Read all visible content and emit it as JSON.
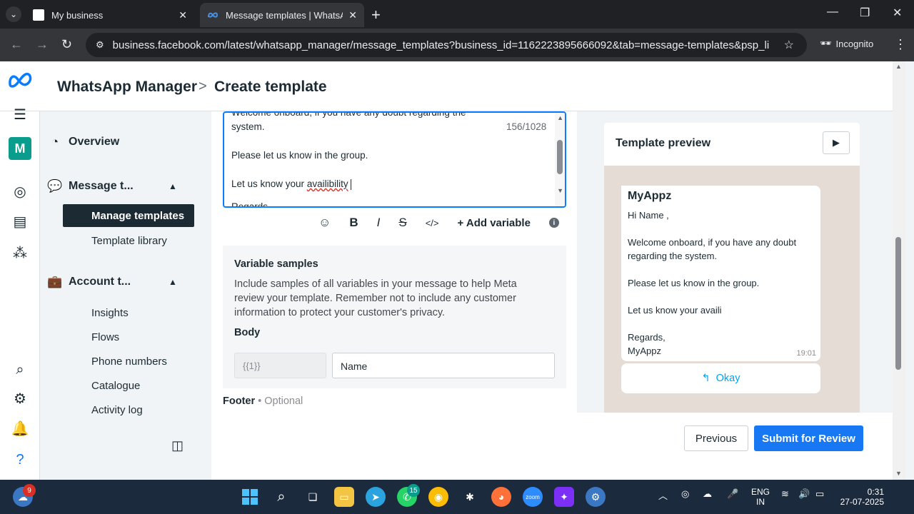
{
  "browser": {
    "tabs": [
      {
        "label": "My business",
        "active": false
      },
      {
        "label": "Message templates | WhatsApp",
        "active": true
      }
    ],
    "url": "business.facebook.com/latest/whatsapp_manager/message_templates?business_id=1162223895666092&tab=message-templates&psp_linking_succ...",
    "incognito_label": "Incognito"
  },
  "header": {
    "app_name": "WhatsApp Manager",
    "separator": ">",
    "page_title": "Create template"
  },
  "sidebar": {
    "overview": "Overview",
    "message_templates": "Message t...",
    "manage_templates": "Manage templates",
    "template_library": "Template library",
    "account_tools": "Account t...",
    "sub_items": [
      "Insights",
      "Flows",
      "Phone numbers",
      "Catalogue",
      "Activity log"
    ]
  },
  "editor": {
    "line_partial": "Welcome onboard, if you have any doubt regarding the",
    "line_system": "system.",
    "line_group": "Please let us know in the group.",
    "line_avail_prefix": "Let us know your ",
    "line_avail_misspelled": "availibility",
    "counter": "156/1028",
    "cut_line": "Regards,"
  },
  "format_toolbar": {
    "emoji": "☺",
    "bold": "B",
    "italic": "I",
    "strike": "S",
    "code": "</>",
    "add_variable": "+ Add variable",
    "info": "i"
  },
  "variable_samples": {
    "title": "Variable samples",
    "description": "Include samples of all variables in your message to help Meta review your template. Remember not to include any customer information to protect your customer's privacy.",
    "body_label": "Body",
    "variable_key": "{{1}}",
    "variable_value": "Name"
  },
  "footer": {
    "label": "Footer",
    "optional": " • Optional"
  },
  "preview": {
    "title": "Template preview",
    "sender": "MyAppz",
    "lines": [
      "Hi Name ,",
      "",
      "Welcome onboard, if you have any doubt",
      "regarding the system.",
      "",
      "Please let us know in the group.",
      "",
      "Let us know your availi",
      "",
      "Regards,",
      "MyAppz"
    ],
    "time": "19:01",
    "button_label": "Okay"
  },
  "actions": {
    "previous": "Previous",
    "submit": "Submit for Review"
  },
  "taskbar": {
    "weather_badge": "9",
    "whatsapp_badge": "15",
    "lang_line1": "ENG",
    "lang_line2": "IN",
    "time": "0:31",
    "date": "27-07-2025"
  },
  "colors": {
    "accent": "#1877f2",
    "whatsapp_teal": "#0a9c8c",
    "nav_active": "#1c2b33"
  }
}
